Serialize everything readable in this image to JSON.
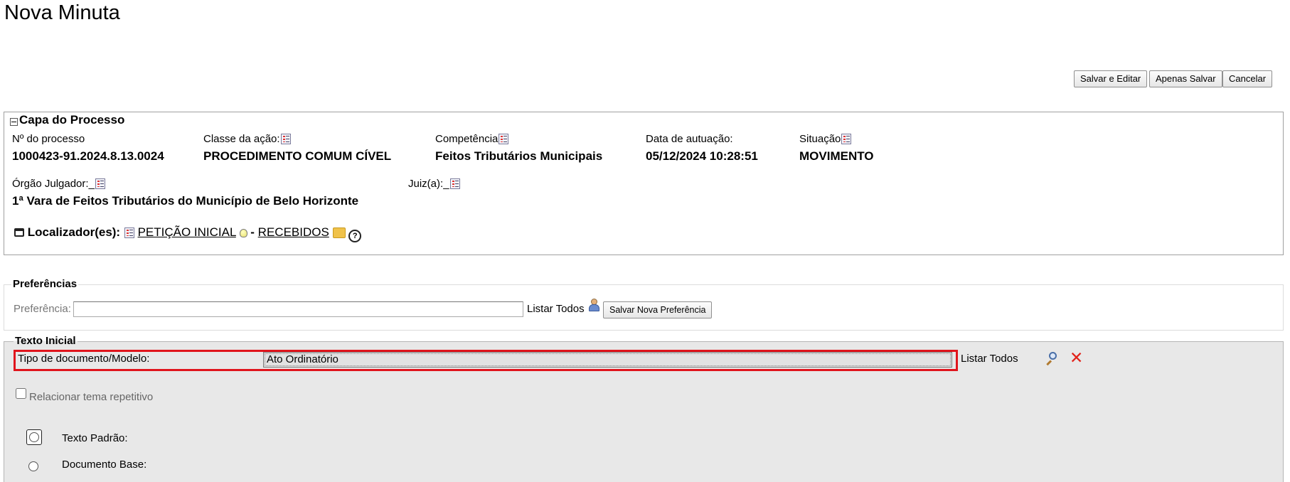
{
  "page_title": "Nova Minuta",
  "actions": {
    "save_edit": "Salvar e Editar",
    "save_only": "Apenas Salvar",
    "cancel": "Cancelar"
  },
  "capa": {
    "legend": "Capa do Processo",
    "numero_label": "Nº do processo",
    "numero_value": "1000423-91.2024.8.13.0024",
    "classe_label": "Classe da ação:",
    "classe_value": "PROCEDIMENTO COMUM CÍVEL",
    "competencia_label": "Competência",
    "competencia_value": "Feitos Tributários Municipais",
    "data_label": "Data de autuação:",
    "data_value": "05/12/2024 10:28:51",
    "situacao_label": "Situação",
    "situacao_value": "MOVIMENTO",
    "orgao_label": "Órgão Julgador:",
    "orgao_value": "1ª Vara de Feitos Tributários do Município de Belo Horizonte",
    "juiz_label": "Juiz(a):",
    "localizador_label": "Localizador(es):",
    "localizador_1": "PETIÇÃO INICIAL",
    "localizador_sep": "-",
    "localizador_2": "RECEBIDOS"
  },
  "preferencias": {
    "legend": "Preferências",
    "label": "Preferência:",
    "input_value": "",
    "listar_todos": "Listar Todos",
    "save_button": "Salvar Nova Preferência"
  },
  "texto_inicial": {
    "legend": "Texto Inicial",
    "tipo_label": "Tipo de documento/Modelo:",
    "tipo_value": "Ato Ordinatório",
    "listar_todos": "Listar Todos",
    "relacionar_label": "Relacionar tema repetitivo",
    "texto_padrao_label": "Texto Padrão:",
    "documento_base_label": "Documento Base:"
  },
  "colors": {
    "highlight": "#e0141c",
    "panel_bg": "#e8e8e8",
    "close_red": "#e2231a"
  }
}
